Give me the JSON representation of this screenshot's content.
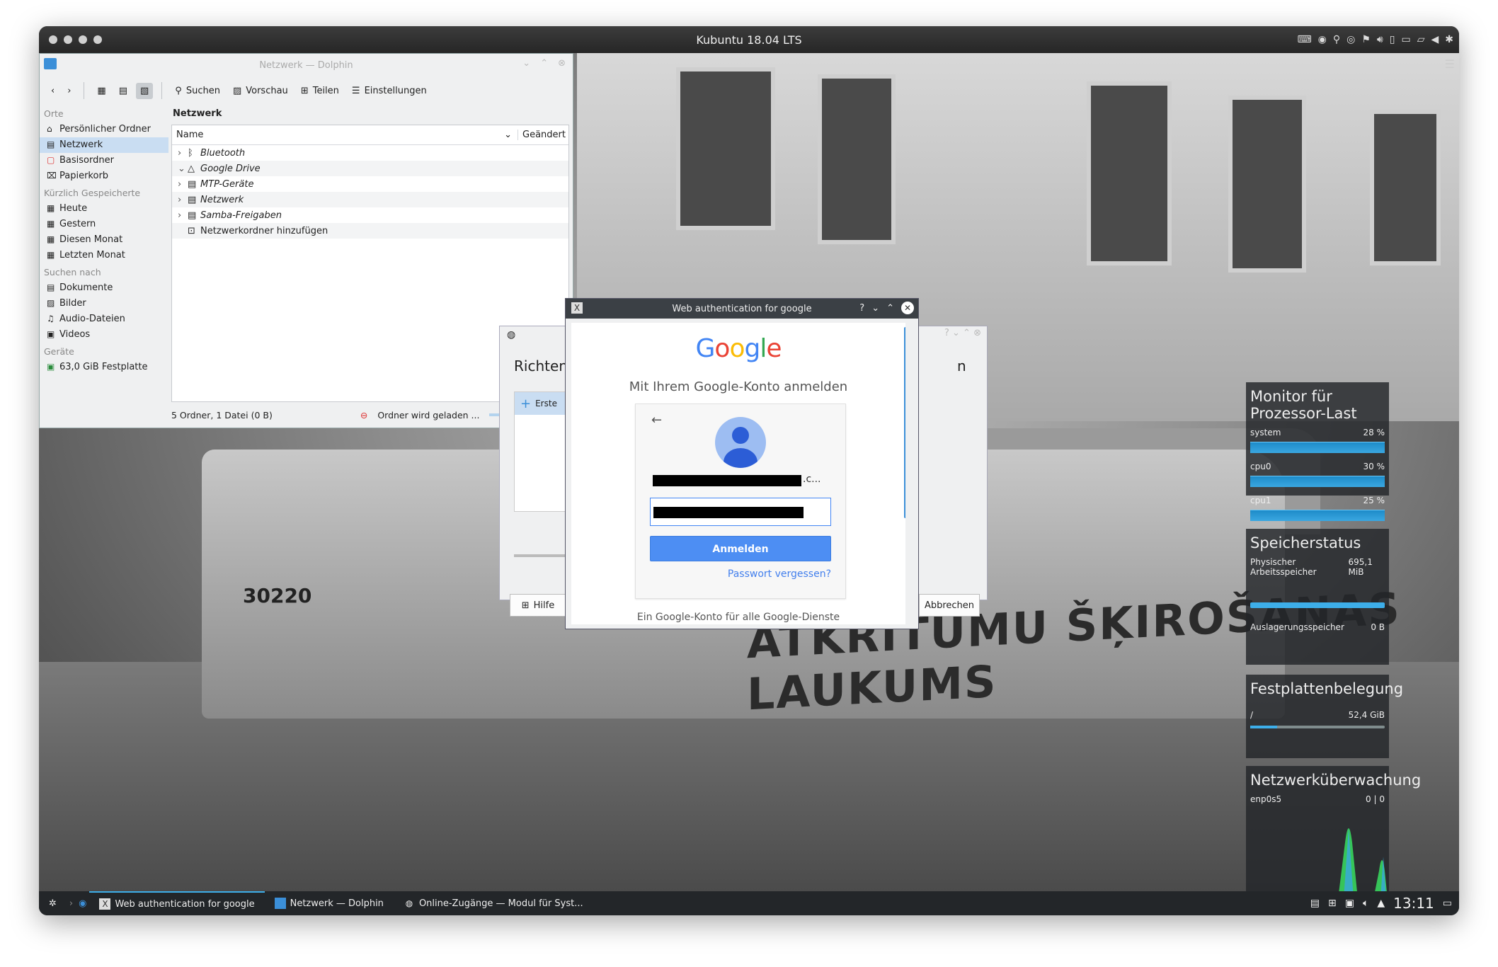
{
  "vm": {
    "title": "Kubuntu 18.04 LTS"
  },
  "dolphin": {
    "title": "Netzwerk — Dolphin",
    "toolbar": {
      "search": "Suchen",
      "preview": "Vorschau",
      "share": "Teilen",
      "settings": "Einstellungen"
    },
    "sidebar": {
      "places_header": "Orte",
      "places": [
        "Persönlicher Ordner",
        "Netzwerk",
        "Basisordner",
        "Papierkorb"
      ],
      "recent_header": "Kürzlich Gespeicherte",
      "recent": [
        "Heute",
        "Gestern",
        "Diesen Monat",
        "Letzten Monat"
      ],
      "search_header": "Suchen nach",
      "search": [
        "Dokumente",
        "Bilder",
        "Audio-Dateien",
        "Videos"
      ],
      "devices_header": "Geräte",
      "devices": [
        "63,0 GiB Festplatte"
      ]
    },
    "breadcrumb": "Netzwerk",
    "columns": {
      "name": "Name",
      "changed": "Geändert"
    },
    "rows": [
      "Bluetooth",
      "Google Drive",
      "MTP-Geräte",
      "Netzwerk",
      "Samba-Freigaben",
      "Netzwerkordner hinzufügen"
    ],
    "status": {
      "count": "5 Ordner, 1 Datei (0 B)",
      "loading": "Ordner wird geladen ..."
    }
  },
  "accounts": {
    "title_left": "Richten",
    "title_right": "n",
    "item": "Erste",
    "help": "Hilfe",
    "cancel": "Abbrechen"
  },
  "webauth": {
    "title": "Web authentication for google",
    "logo": "Google",
    "subtitle": "Mit Ihrem Google-Konto anmelden",
    "email_suffix": ".c...",
    "signin": "Anmelden",
    "forgot": "Passwort vergessen?",
    "footer": "Ein Google-Konto für alle Google-Dienste"
  },
  "widgets": {
    "cpu": {
      "title": "Monitor für Prozessor-Last",
      "rows": [
        {
          "label": "system",
          "value": "28 %"
        },
        {
          "label": "cpu0",
          "value": "30 %"
        },
        {
          "label": "cpu1",
          "value": "25 %"
        }
      ]
    },
    "mem": {
      "title": "Speicherstatus",
      "phys_label": "Physischer Arbeitsspeicher",
      "phys_value": "695,1 MiB",
      "swap_label": "Auslagerungsspeicher",
      "swap_value": "0 B"
    },
    "disk": {
      "title": "Festplattenbelegung",
      "mount": "/",
      "value": "52,4 GiB"
    },
    "net": {
      "title": "Netzwerküberwachung",
      "iface": "enp0s5",
      "value": "0 | 0"
    }
  },
  "tramtext": "ATKRITUMU ŠĶIROŠANAS LAUKUMS",
  "tramnum": "30220",
  "taskbar": {
    "items": [
      "Web authentication for google",
      "Netzwerk — Dolphin",
      "Online-Zugänge — Modul für Syst..."
    ],
    "clock": "13:11"
  }
}
